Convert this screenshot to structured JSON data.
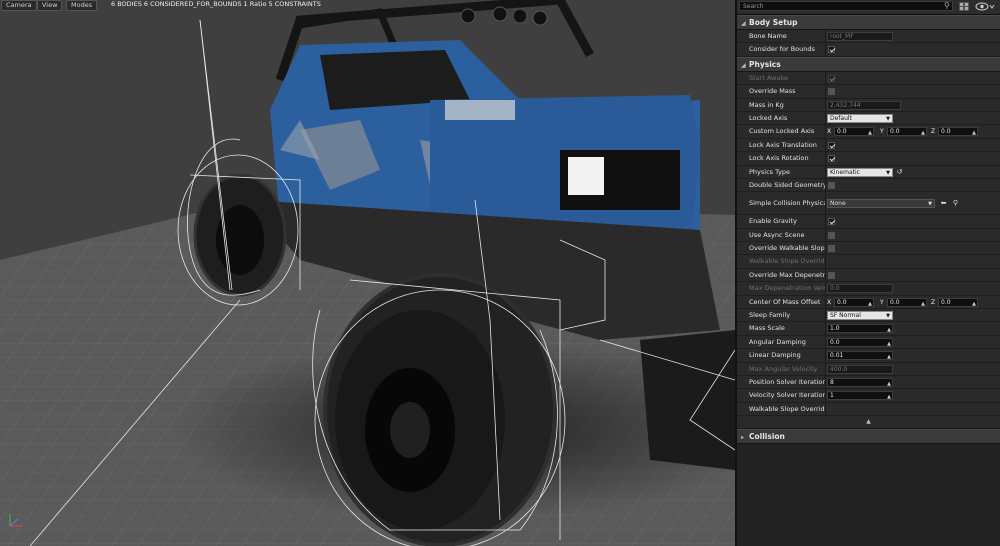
{
  "viewport": {
    "buttons": [
      "Camera",
      "View",
      "Modes"
    ],
    "stats": "6 BODIES  6 CONSIDERED_FOR_BOUNDS  1 Ratio  5 CONSTRAINTS"
  },
  "details": {
    "search_placeholder": "Search",
    "sections": {
      "body_setup": {
        "title": "Body Setup",
        "bone_name_label": "Bone Name",
        "bone_name_value": "root_MF",
        "consider_bounds_label": "Consider for Bounds"
      },
      "physics": {
        "title": "Physics",
        "start_awake": "Start Awake",
        "override_mass": "Override Mass",
        "mass_in_kg": "Mass in Kg",
        "mass_value": "2,432.744",
        "locked_axis": "Locked Axis",
        "locked_axis_value": "Default",
        "custom_locked_axis": "Custom Locked Axis",
        "vec_x": "0.0",
        "vec_y": "0.0",
        "vec_z": "0.0",
        "lock_axis_translation": "Lock Axis Translation",
        "lock_axis_rotation": "Lock Axis Rotation",
        "physics_type": "Physics Type",
        "physics_type_value": "Kinematic",
        "double_sided_geometry": "Double Sided Geometry",
        "simple_collision_physical": "Simple Collision Physical",
        "simple_collision_value": "None",
        "enable_gravity": "Enable Gravity",
        "use_async_scene": "Use Async Scene",
        "override_walkable_slope": "Override Walkable Slope o",
        "walkable_slope_override_1": "Walkable Slope Override",
        "override_max_depenetration": "Override Max Depenetrati",
        "max_depenetration_velocity": "Max Depenetration Velocit",
        "max_depenetration_value": "0.0",
        "center_of_mass_offset": "Center Of Mass Offset",
        "com_x": "0.0",
        "com_y": "0.0",
        "com_z": "0.0",
        "sleep_family": "Sleep Family",
        "sleep_family_value": "SF Normal",
        "mass_scale": "Mass Scale",
        "mass_scale_value": "1.0",
        "angular_damping": "Angular Damping",
        "angular_damping_value": "0.0",
        "linear_damping": "Linear Damping",
        "linear_damping_value": "0.01",
        "max_angular_velocity": "Max Angular Velocity",
        "max_angular_velocity_value": "400.0",
        "position_solver": "Position Solver Iteration C",
        "position_solver_value": "8",
        "velocity_solver": "Velocity Solver Iteration C",
        "velocity_solver_value": "1",
        "walkable_slope_override_2": "Walkable Slope Override"
      },
      "collision": {
        "title": "Collision"
      }
    },
    "vec_labels": {
      "x": "X",
      "y": "Y",
      "z": "Z"
    }
  }
}
